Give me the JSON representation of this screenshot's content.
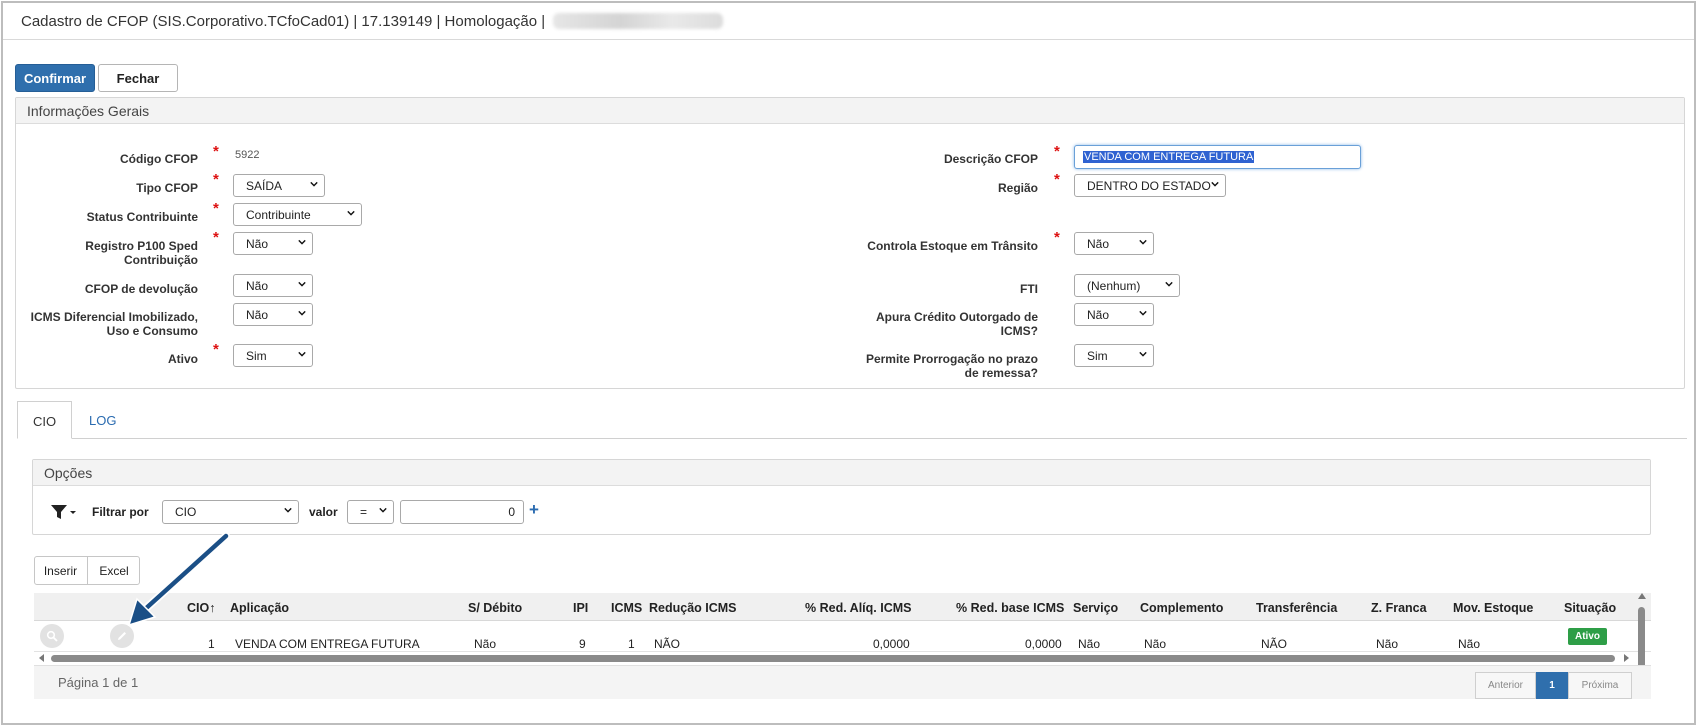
{
  "window": {
    "title": "Cadastro de CFOP (SIS.Corporativo.TCfoCad01) | 17.139149 | Homologação |"
  },
  "toolbar": {
    "confirm_label": "Confirmar",
    "close_label": "Fechar"
  },
  "general_info": {
    "header": "Informações Gerais",
    "codigo_label": "Código CFOP",
    "codigo_value": "5922",
    "descricao_label": "Descrição CFOP",
    "descricao_value": "VENDA COM ENTREGA FUTURA",
    "tipo_label": "Tipo CFOP",
    "tipo_value": "SAÍDA",
    "regiao_label": "Região",
    "regiao_value": "DENTRO DO ESTADO",
    "status_label": "Status Contribuinte",
    "status_value": "Contribuinte",
    "registro_label_1": "Registro P100 Sped",
    "registro_label_2": "Contribuição",
    "registro_value": "Não",
    "controla_label": "Controla Estoque em Trânsito",
    "controla_value": "Não",
    "devolucao_label": "CFOP de devolução",
    "devolucao_value": "Não",
    "fti_label": "FTI",
    "fti_value": "(Nenhum)",
    "icms_dif_label_1": "ICMS Diferencial Imobilizado,",
    "icms_dif_label_2": "Uso e Consumo",
    "icms_dif_value": "Não",
    "apura_label_1": "Apura Crédito Outorgado de",
    "apura_label_2": "ICMS?",
    "apura_value": "Não",
    "ativo_label": "Ativo",
    "ativo_value": "Sim",
    "permite_label_1": "Permite Prorrogação no prazo",
    "permite_label_2": "de remessa?",
    "permite_value": "Sim",
    "required_mark": "*"
  },
  "tabs": [
    {
      "label": "CIO",
      "active": true
    },
    {
      "label": "LOG",
      "active": false
    }
  ],
  "options": {
    "header": "Opções",
    "filter_label": "Filtrar por",
    "filter_field": "CIO",
    "valor_label": "valor",
    "operator": "=",
    "filter_value": "0",
    "add_symbol": "+"
  },
  "grid_actions": {
    "insert_label": "Inserir",
    "excel_label": "Excel"
  },
  "grid": {
    "columns": [
      "CIO",
      "Aplicação",
      "S/ Débito",
      "IPI",
      "ICMS",
      "Redução ICMS",
      "% Red. Alíq. ICMS",
      "% Red. base ICMS",
      "Serviço",
      "Complemento",
      "Transferência",
      "Z. Franca",
      "Mov. Estoque",
      "Situação"
    ],
    "sort_arrow": "↑",
    "rows": [
      {
        "cio": "1",
        "aplicacao": "VENDA COM ENTREGA FUTURA",
        "s_debito": "Não",
        "ipi": "9",
        "icms": "1",
        "reducao_icms": "NÃO",
        "red_aliq": "0,0000",
        "red_base": "0,0000",
        "servico": "Não",
        "complemento": "Não",
        "transferencia": "NÃO",
        "z_franca": "Não",
        "mov_estoque": "Não",
        "situacao": "Ativo"
      }
    ]
  },
  "pager": {
    "page_text": "Página 1 de 1",
    "prev_label": "Anterior",
    "current": "1",
    "next_label": "Próxima"
  },
  "colors": {
    "primary": "#2f6fad",
    "required": "#dd1111",
    "active_badge": "#2e9e47",
    "link": "#2a6bb0"
  }
}
